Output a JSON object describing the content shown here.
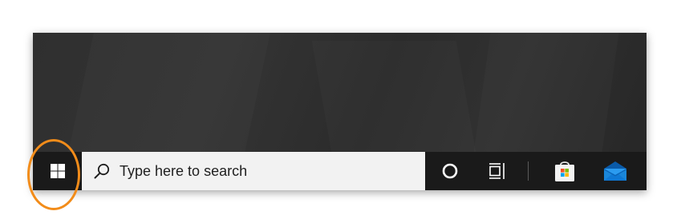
{
  "taskbar": {
    "start_button": {
      "icon": "windows-logo-icon"
    },
    "search": {
      "icon": "search-icon",
      "placeholder": "Type here to search"
    },
    "icons": [
      {
        "name": "cortana-icon"
      },
      {
        "name": "task-view-icon"
      },
      {
        "name": "microsoft-store-icon"
      },
      {
        "name": "mail-icon"
      }
    ]
  },
  "colors": {
    "desktop": "#2e2e2e",
    "taskbar": "#1a1a1a",
    "search_box": "#f2f2f2",
    "highlight": "#f28c1a",
    "mail_blue": "#0f78d4"
  }
}
